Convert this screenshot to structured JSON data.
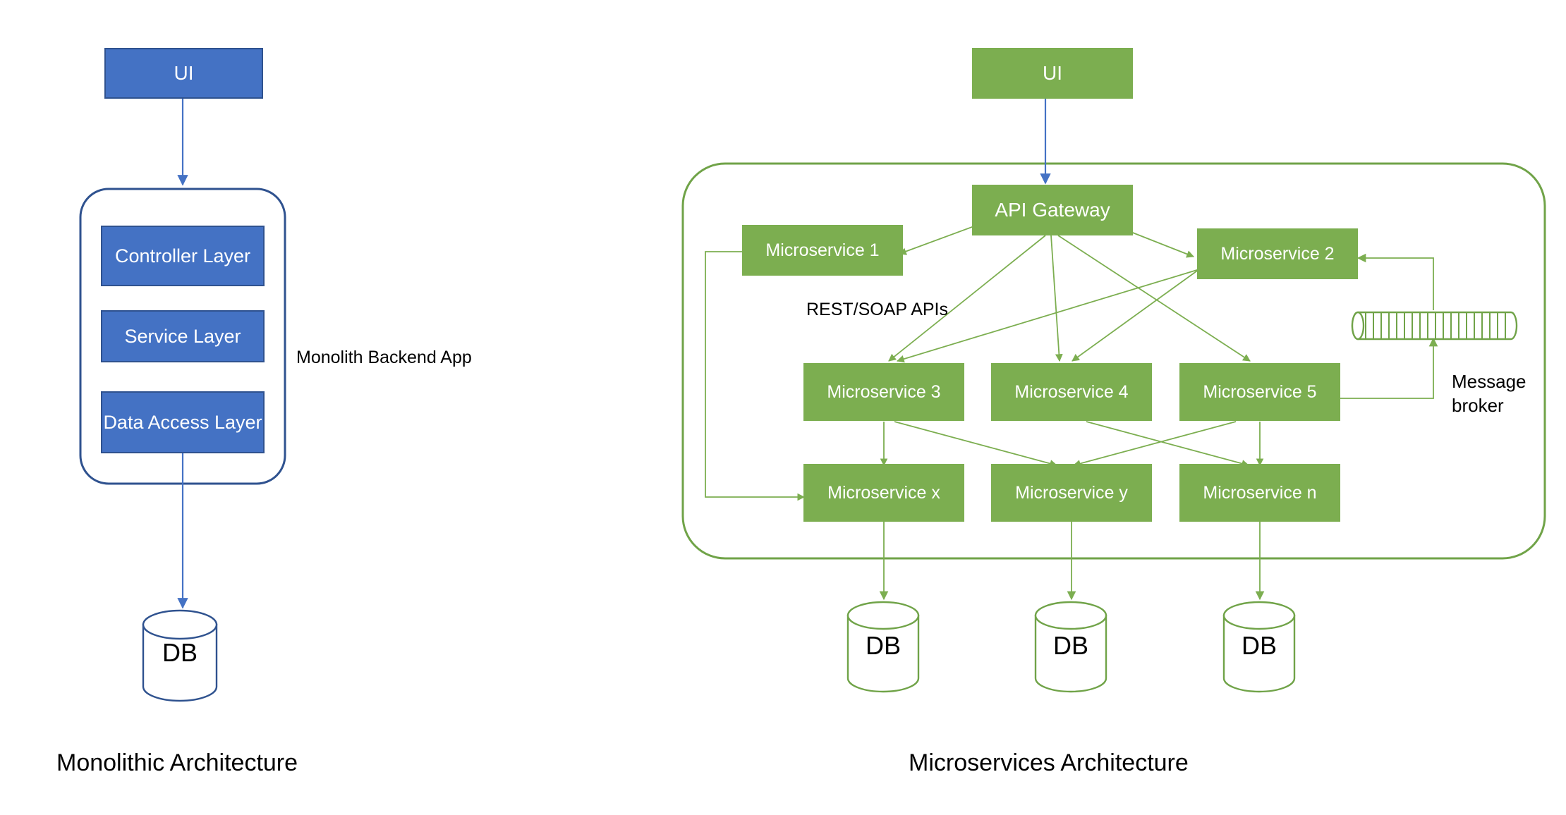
{
  "diagram": {
    "background": "#ffffff",
    "colors": {
      "blue_fill": "#4472C4",
      "blue_stroke": "#2F528F",
      "green_fill": "#7CAE50",
      "green_stroke": "#70A348",
      "text_dark": "#000000",
      "text_light": "#ffffff"
    }
  },
  "monolith": {
    "title": "Monolithic Architecture",
    "ui_box": {
      "label": "UI"
    },
    "container_label": "Monolith Backend App",
    "layers": [
      {
        "label": "Controller Layer"
      },
      {
        "label": "Service Layer"
      },
      {
        "label": "Data Access Layer"
      }
    ],
    "database": {
      "label": "DB"
    }
  },
  "microservices": {
    "title": "Microservices Architecture",
    "ui_box": {
      "label": "UI"
    },
    "gateway": {
      "label": "API Gateway"
    },
    "api_label": "REST/SOAP APIs",
    "broker_label_line1": "Message",
    "broker_label_line2": "broker",
    "services": [
      {
        "id": "ms1",
        "label": "Microservice 1"
      },
      {
        "id": "ms2",
        "label": "Microservice 2"
      },
      {
        "id": "ms3",
        "label": "Microservice 3"
      },
      {
        "id": "ms4",
        "label": "Microservice 4"
      },
      {
        "id": "ms5",
        "label": "Microservice 5"
      },
      {
        "id": "msx",
        "label": "Microservice x"
      },
      {
        "id": "msy",
        "label": "Microservice y"
      },
      {
        "id": "msn",
        "label": "Microservice n"
      }
    ],
    "databases": [
      {
        "label": "DB"
      },
      {
        "label": "DB"
      },
      {
        "label": "DB"
      }
    ]
  }
}
